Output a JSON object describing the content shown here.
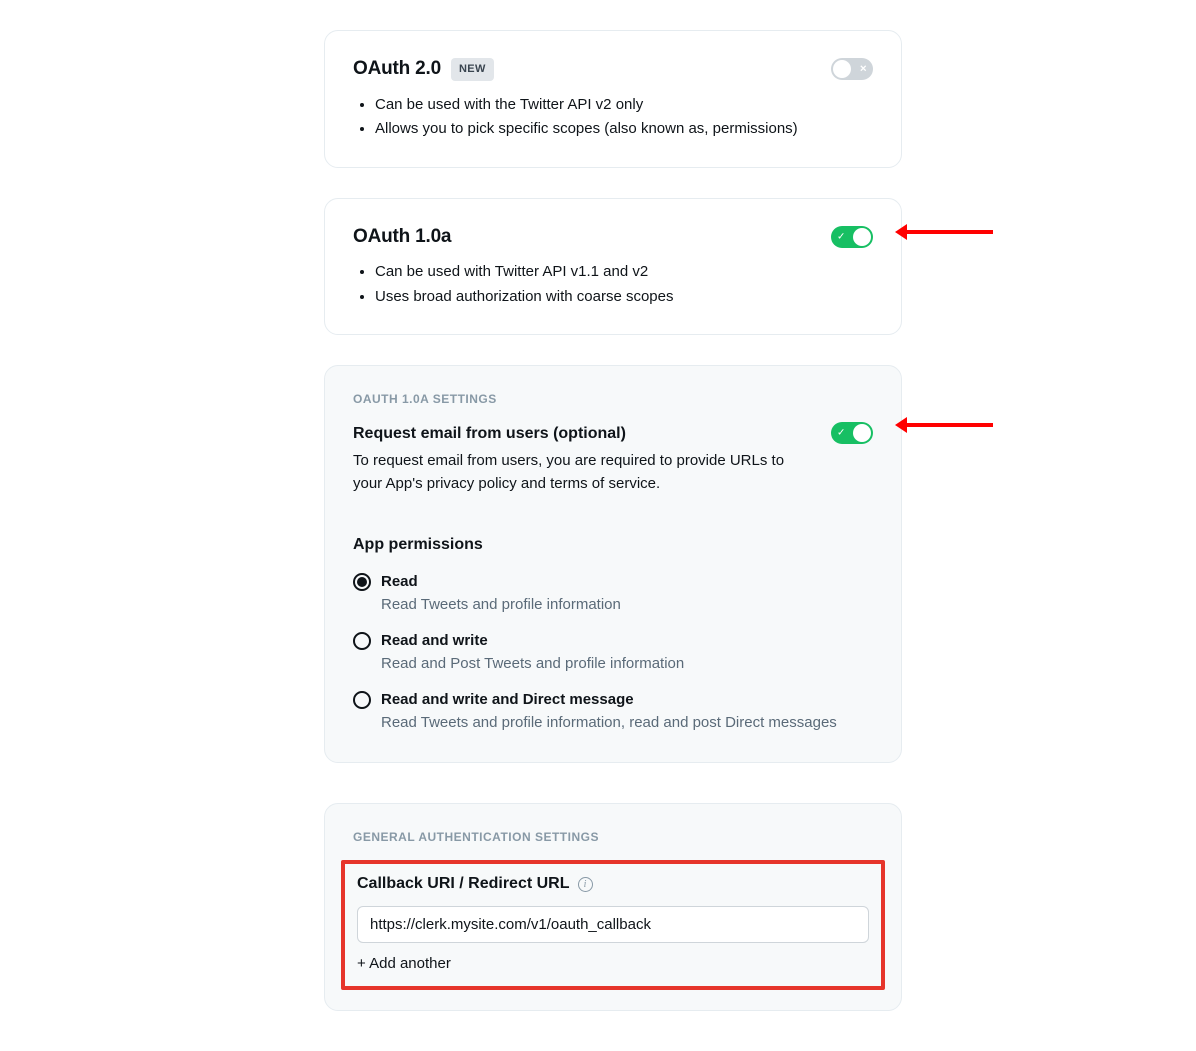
{
  "oauth2": {
    "title": "OAuth 2.0",
    "badge": "NEW",
    "enabled": false,
    "bullets": [
      "Can be used with the Twitter API v2 only",
      "Allows you to pick specific scopes (also known as, permissions)"
    ]
  },
  "oauth1": {
    "title": "OAuth 1.0a",
    "enabled": true,
    "bullets": [
      "Can be used with Twitter API v1.1 and v2",
      "Uses broad authorization with coarse scopes"
    ]
  },
  "oauth1_settings": {
    "section_label": "OAUTH 1.0A SETTINGS",
    "request_email_title": "Request email from users (optional)",
    "request_email_enabled": true,
    "request_email_desc": "To request email from users, you are required to provide URLs to your App's privacy policy and terms of service.",
    "permissions_title": "App permissions",
    "permissions": [
      {
        "label": "Read",
        "desc": "Read Tweets and profile information",
        "selected": true
      },
      {
        "label": "Read and write",
        "desc": "Read and Post Tweets and profile information",
        "selected": false
      },
      {
        "label": "Read and write and Direct message",
        "desc": "Read Tweets and profile information, read and post Direct messages",
        "selected": false
      }
    ]
  },
  "general_auth": {
    "section_label": "GENERAL AUTHENTICATION SETTINGS",
    "callback_title": "Callback URI / Redirect URL",
    "callback_value": "https://clerk.mysite.com/v1/oauth_callback",
    "add_another_label": "+ Add another"
  }
}
